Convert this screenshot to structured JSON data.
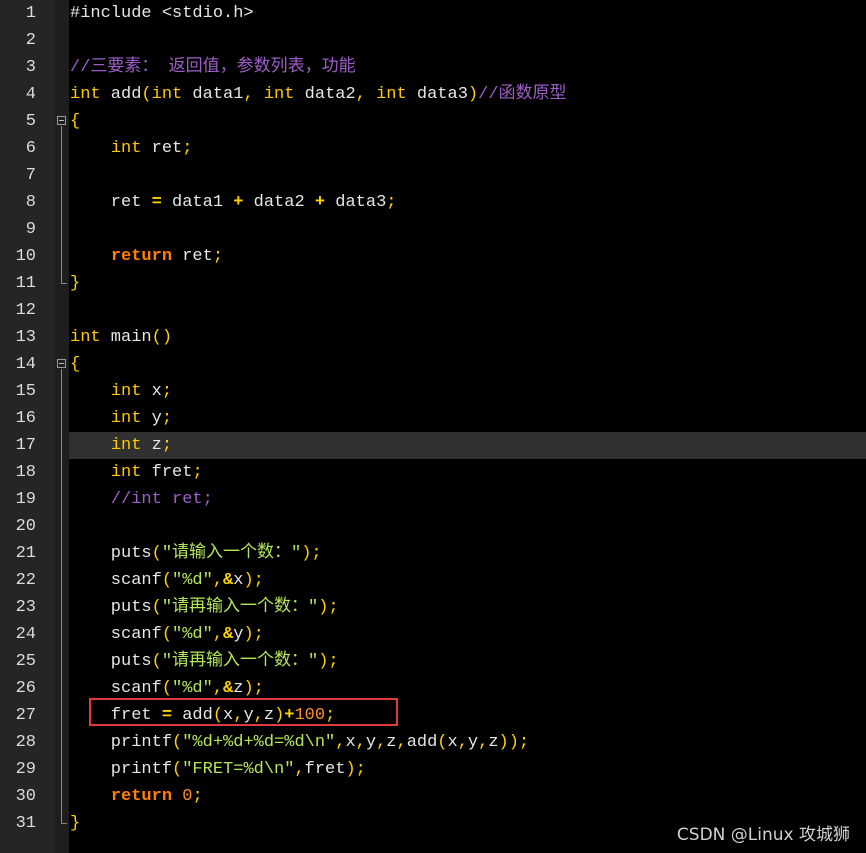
{
  "editor": {
    "lines": [
      {
        "n": "1",
        "tokens": [
          {
            "t": "#include <stdio.h>",
            "c": "default"
          }
        ]
      },
      {
        "n": "2",
        "tokens": []
      },
      {
        "n": "3",
        "tokens": [
          {
            "t": "//三要素： 返回值，参数列表，功能",
            "c": "comment"
          }
        ]
      },
      {
        "n": "4",
        "tokens": [
          {
            "t": "int",
            "c": "type"
          },
          {
            "t": " add",
            "c": "default"
          },
          {
            "t": "(",
            "c": "punct"
          },
          {
            "t": "int",
            "c": "type"
          },
          {
            "t": " data1",
            "c": "default"
          },
          {
            "t": ",",
            "c": "punct"
          },
          {
            "t": " ",
            "c": "default"
          },
          {
            "t": "int",
            "c": "type"
          },
          {
            "t": " data2",
            "c": "default"
          },
          {
            "t": ",",
            "c": "punct"
          },
          {
            "t": " ",
            "c": "default"
          },
          {
            "t": "int",
            "c": "type"
          },
          {
            "t": " data3",
            "c": "default"
          },
          {
            "t": ")",
            "c": "punct"
          },
          {
            "t": "//函数原型",
            "c": "comment"
          }
        ]
      },
      {
        "n": "5",
        "tokens": [
          {
            "t": "{",
            "c": "punct"
          }
        ]
      },
      {
        "n": "6",
        "tokens": [
          {
            "t": "    ",
            "c": "default"
          },
          {
            "t": "int",
            "c": "type"
          },
          {
            "t": " ret",
            "c": "default"
          },
          {
            "t": ";",
            "c": "punct"
          }
        ]
      },
      {
        "n": "7",
        "tokens": []
      },
      {
        "n": "8",
        "tokens": [
          {
            "t": "    ret ",
            "c": "default"
          },
          {
            "t": "=",
            "c": "op"
          },
          {
            "t": " data1 ",
            "c": "default"
          },
          {
            "t": "+",
            "c": "op"
          },
          {
            "t": " data2 ",
            "c": "default"
          },
          {
            "t": "+",
            "c": "op"
          },
          {
            "t": " data3",
            "c": "default"
          },
          {
            "t": ";",
            "c": "punct"
          }
        ]
      },
      {
        "n": "9",
        "tokens": []
      },
      {
        "n": "10",
        "tokens": [
          {
            "t": "    ",
            "c": "default"
          },
          {
            "t": "return",
            "c": "kw"
          },
          {
            "t": " ret",
            "c": "default"
          },
          {
            "t": ";",
            "c": "punct"
          }
        ]
      },
      {
        "n": "11",
        "tokens": [
          {
            "t": "}",
            "c": "punct"
          }
        ]
      },
      {
        "n": "12",
        "tokens": []
      },
      {
        "n": "13",
        "tokens": [
          {
            "t": "int",
            "c": "type"
          },
          {
            "t": " main",
            "c": "default"
          },
          {
            "t": "()",
            "c": "punct"
          }
        ]
      },
      {
        "n": "14",
        "tokens": [
          {
            "t": "{",
            "c": "punct"
          }
        ]
      },
      {
        "n": "15",
        "tokens": [
          {
            "t": "    ",
            "c": "default"
          },
          {
            "t": "int",
            "c": "type"
          },
          {
            "t": " x",
            "c": "default"
          },
          {
            "t": ";",
            "c": "punct"
          }
        ]
      },
      {
        "n": "16",
        "tokens": [
          {
            "t": "    ",
            "c": "default"
          },
          {
            "t": "int",
            "c": "type"
          },
          {
            "t": " y",
            "c": "default"
          },
          {
            "t": ";",
            "c": "punct"
          }
        ]
      },
      {
        "n": "17",
        "tokens": [
          {
            "t": "    ",
            "c": "default"
          },
          {
            "t": "int",
            "c": "type"
          },
          {
            "t": " z",
            "c": "default"
          },
          {
            "t": ";",
            "c": "punct"
          }
        ]
      },
      {
        "n": "18",
        "tokens": [
          {
            "t": "    ",
            "c": "default"
          },
          {
            "t": "int",
            "c": "type"
          },
          {
            "t": " fret",
            "c": "default"
          },
          {
            "t": ";",
            "c": "punct"
          }
        ]
      },
      {
        "n": "19",
        "tokens": [
          {
            "t": "    ",
            "c": "default"
          },
          {
            "t": "//int ret;",
            "c": "comment"
          }
        ]
      },
      {
        "n": "20",
        "tokens": []
      },
      {
        "n": "21",
        "tokens": [
          {
            "t": "    puts",
            "c": "default"
          },
          {
            "t": "(",
            "c": "punct"
          },
          {
            "t": "\"请输入一个数：\"",
            "c": "str"
          },
          {
            "t": ");",
            "c": "punct"
          }
        ]
      },
      {
        "n": "22",
        "tokens": [
          {
            "t": "    scanf",
            "c": "default"
          },
          {
            "t": "(",
            "c": "punct"
          },
          {
            "t": "\"%d\"",
            "c": "str"
          },
          {
            "t": ",",
            "c": "punct"
          },
          {
            "t": "&",
            "c": "op"
          },
          {
            "t": "x",
            "c": "default"
          },
          {
            "t": ");",
            "c": "punct"
          }
        ]
      },
      {
        "n": "23",
        "tokens": [
          {
            "t": "    puts",
            "c": "default"
          },
          {
            "t": "(",
            "c": "punct"
          },
          {
            "t": "\"请再输入一个数：\"",
            "c": "str"
          },
          {
            "t": ");",
            "c": "punct"
          }
        ]
      },
      {
        "n": "24",
        "tokens": [
          {
            "t": "    scanf",
            "c": "default"
          },
          {
            "t": "(",
            "c": "punct"
          },
          {
            "t": "\"%d\"",
            "c": "str"
          },
          {
            "t": ",",
            "c": "punct"
          },
          {
            "t": "&",
            "c": "op"
          },
          {
            "t": "y",
            "c": "default"
          },
          {
            "t": ");",
            "c": "punct"
          }
        ]
      },
      {
        "n": "25",
        "tokens": [
          {
            "t": "    puts",
            "c": "default"
          },
          {
            "t": "(",
            "c": "punct"
          },
          {
            "t": "\"请再输入一个数：\"",
            "c": "str"
          },
          {
            "t": ");",
            "c": "punct"
          }
        ]
      },
      {
        "n": "26",
        "tokens": [
          {
            "t": "    scanf",
            "c": "default"
          },
          {
            "t": "(",
            "c": "punct"
          },
          {
            "t": "\"%d\"",
            "c": "str"
          },
          {
            "t": ",",
            "c": "punct"
          },
          {
            "t": "&",
            "c": "op"
          },
          {
            "t": "z",
            "c": "default"
          },
          {
            "t": ");",
            "c": "punct"
          }
        ]
      },
      {
        "n": "27",
        "tokens": [
          {
            "t": "    fret ",
            "c": "default"
          },
          {
            "t": "=",
            "c": "op"
          },
          {
            "t": " add",
            "c": "default"
          },
          {
            "t": "(",
            "c": "punct"
          },
          {
            "t": "x",
            "c": "default"
          },
          {
            "t": ",",
            "c": "punct"
          },
          {
            "t": "y",
            "c": "default"
          },
          {
            "t": ",",
            "c": "punct"
          },
          {
            "t": "z",
            "c": "default"
          },
          {
            "t": ")",
            "c": "punct"
          },
          {
            "t": "+",
            "c": "op"
          },
          {
            "t": "100",
            "c": "num"
          },
          {
            "t": ";",
            "c": "punct"
          }
        ]
      },
      {
        "n": "28",
        "tokens": [
          {
            "t": "    printf",
            "c": "default"
          },
          {
            "t": "(",
            "c": "punct"
          },
          {
            "t": "\"%d+%d+%d=%d\\n\"",
            "c": "str"
          },
          {
            "t": ",",
            "c": "punct"
          },
          {
            "t": "x",
            "c": "default"
          },
          {
            "t": ",",
            "c": "punct"
          },
          {
            "t": "y",
            "c": "default"
          },
          {
            "t": ",",
            "c": "punct"
          },
          {
            "t": "z",
            "c": "default"
          },
          {
            "t": ",",
            "c": "punct"
          },
          {
            "t": "add",
            "c": "default"
          },
          {
            "t": "(",
            "c": "punct"
          },
          {
            "t": "x",
            "c": "default"
          },
          {
            "t": ",",
            "c": "punct"
          },
          {
            "t": "y",
            "c": "default"
          },
          {
            "t": ",",
            "c": "punct"
          },
          {
            "t": "z",
            "c": "default"
          },
          {
            "t": "));",
            "c": "punct"
          }
        ]
      },
      {
        "n": "29",
        "tokens": [
          {
            "t": "    printf",
            "c": "default"
          },
          {
            "t": "(",
            "c": "punct"
          },
          {
            "t": "\"FRET=%d\\n\"",
            "c": "str"
          },
          {
            "t": ",",
            "c": "punct"
          },
          {
            "t": "fret",
            "c": "default"
          },
          {
            "t": ");",
            "c": "punct"
          }
        ]
      },
      {
        "n": "30",
        "tokens": [
          {
            "t": "    ",
            "c": "default"
          },
          {
            "t": "return",
            "c": "kw"
          },
          {
            "t": " ",
            "c": "default"
          },
          {
            "t": "0",
            "c": "num"
          },
          {
            "t": ";",
            "c": "punct"
          }
        ]
      },
      {
        "n": "31",
        "tokens": [
          {
            "t": "}",
            "c": "punct"
          }
        ]
      }
    ],
    "current_line": "17",
    "highlighted_line": "27",
    "colors": {
      "background": "#000000",
      "gutter": "#252525",
      "current_line": "#303030",
      "highlight_box": "#e03a3a",
      "type": "#ffc800",
      "keyword": "#ff8000",
      "string": "#b4e65a",
      "comment": "#9d5fc7",
      "number": "#ff8c28"
    }
  },
  "watermark": "CSDN @Linux 攻城狮"
}
